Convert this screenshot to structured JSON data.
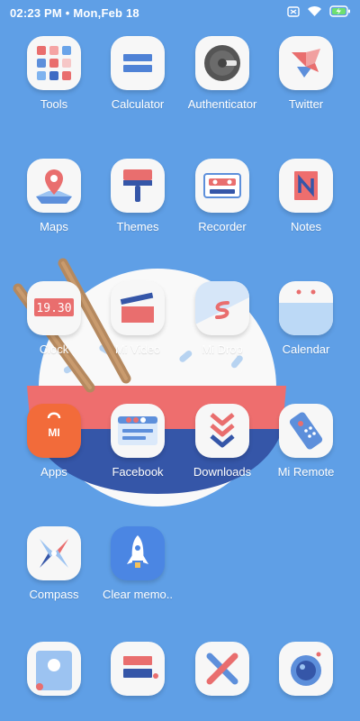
{
  "status": {
    "time": "02:23 PM",
    "date": "Mon,Feb 18",
    "icons": [
      "sim-off-icon",
      "wifi-icon",
      "battery-charging-icon"
    ]
  },
  "rows": [
    [
      {
        "label": "Tools",
        "icon": "tools-folder-icon"
      },
      {
        "label": "Calculator",
        "icon": "calculator-icon"
      },
      {
        "label": "Authenticator",
        "icon": "authenticator-icon"
      },
      {
        "label": "Twitter",
        "icon": "twitter-icon"
      }
    ],
    [
      {
        "label": "Maps",
        "icon": "maps-icon"
      },
      {
        "label": "Themes",
        "icon": "themes-icon"
      },
      {
        "label": "Recorder",
        "icon": "recorder-icon"
      },
      {
        "label": "Notes",
        "icon": "notes-icon"
      }
    ],
    [
      {
        "label": "Clock",
        "icon": "clock-icon",
        "display": "19.30"
      },
      {
        "label": "Mi Video",
        "icon": "video-icon"
      },
      {
        "label": "Mi Drop",
        "icon": "drop-icon"
      },
      {
        "label": "Calendar",
        "icon": "calendar-icon"
      }
    ],
    [
      {
        "label": "Apps",
        "icon": "app-store-icon",
        "badge": "MI"
      },
      {
        "label": "Facebook",
        "icon": "facebook-icon"
      },
      {
        "label": "Downloads",
        "icon": "downloads-icon"
      },
      {
        "label": "Mi Remote",
        "icon": "remote-icon"
      }
    ],
    [
      {
        "label": "Compass",
        "icon": "compass-icon"
      },
      {
        "label": "Clear memo..",
        "icon": "clear-memory-icon"
      }
    ],
    [
      {
        "label": "",
        "icon": "contacts-icon"
      },
      {
        "label": "",
        "icon": "messages-icon"
      },
      {
        "label": "",
        "icon": "browser-icon"
      },
      {
        "label": "",
        "icon": "camera-icon"
      }
    ]
  ],
  "colors": {
    "background": "#5f9fe6",
    "accent_red": "#ee6e6e",
    "accent_orange": "#f26b3a",
    "navy": "#3556a8"
  }
}
